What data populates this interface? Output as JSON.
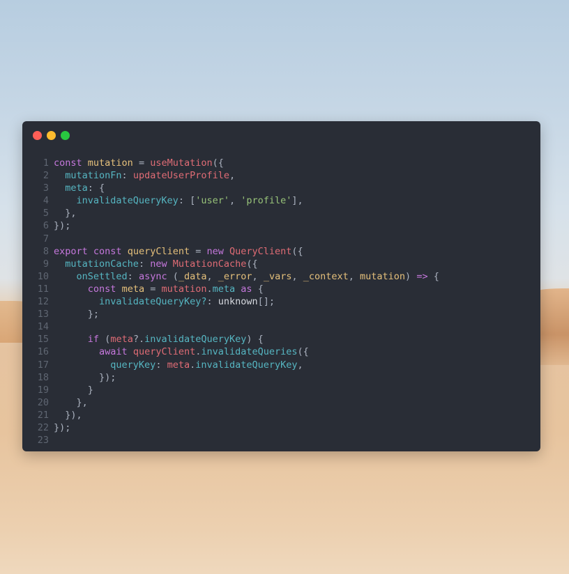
{
  "window": {
    "controls": [
      "close",
      "minimize",
      "maximize"
    ],
    "colors": {
      "close": "#ff5f57",
      "minimize": "#febc2e",
      "maximize": "#28c840"
    }
  },
  "code": {
    "lines": [
      {
        "n": "1",
        "tokens": [
          [
            "kw",
            "const "
          ],
          [
            "var",
            "mutation"
          ],
          [
            "punc",
            " = "
          ],
          [
            "fn",
            "useMutation"
          ],
          [
            "punc",
            "({"
          ]
        ]
      },
      {
        "n": "2",
        "tokens": [
          [
            "punc",
            "  "
          ],
          [
            "prop",
            "mutationFn"
          ],
          [
            "punc",
            ": "
          ],
          [
            "fn",
            "updateUserProfile"
          ],
          [
            "punc",
            ","
          ]
        ]
      },
      {
        "n": "3",
        "tokens": [
          [
            "punc",
            "  "
          ],
          [
            "prop",
            "meta"
          ],
          [
            "punc",
            ": {"
          ]
        ]
      },
      {
        "n": "4",
        "tokens": [
          [
            "punc",
            "    "
          ],
          [
            "prop",
            "invalidateQueryKey"
          ],
          [
            "punc",
            ": ["
          ],
          [
            "str",
            "'user'"
          ],
          [
            "punc",
            ", "
          ],
          [
            "str",
            "'profile'"
          ],
          [
            "punc",
            "],"
          ]
        ]
      },
      {
        "n": "5",
        "tokens": [
          [
            "punc",
            "  },"
          ]
        ]
      },
      {
        "n": "6",
        "tokens": [
          [
            "punc",
            "});"
          ]
        ]
      },
      {
        "n": "7",
        "tokens": []
      },
      {
        "n": "8",
        "tokens": [
          [
            "kw",
            "export "
          ],
          [
            "kw",
            "const "
          ],
          [
            "var",
            "queryClient"
          ],
          [
            "punc",
            " = "
          ],
          [
            "kw",
            "new "
          ],
          [
            "fn",
            "QueryClient"
          ],
          [
            "punc",
            "({"
          ]
        ]
      },
      {
        "n": "9",
        "tokens": [
          [
            "punc",
            "  "
          ],
          [
            "prop",
            "mutationCache"
          ],
          [
            "punc",
            ": "
          ],
          [
            "kw",
            "new "
          ],
          [
            "fn",
            "MutationCache"
          ],
          [
            "punc",
            "({"
          ]
        ]
      },
      {
        "n": "10",
        "tokens": [
          [
            "punc",
            "    "
          ],
          [
            "prop",
            "onSettled"
          ],
          [
            "punc",
            ": "
          ],
          [
            "kw",
            "async "
          ],
          [
            "punc",
            "("
          ],
          [
            "var",
            "_data"
          ],
          [
            "punc",
            ", "
          ],
          [
            "var",
            "_error"
          ],
          [
            "punc",
            ", "
          ],
          [
            "var",
            "_vars"
          ],
          [
            "punc",
            ", "
          ],
          [
            "var",
            "_context"
          ],
          [
            "punc",
            ", "
          ],
          [
            "var",
            "mutation"
          ],
          [
            "punc",
            ") "
          ],
          [
            "kw",
            "=>"
          ],
          [
            "punc",
            " {"
          ]
        ]
      },
      {
        "n": "11",
        "tokens": [
          [
            "punc",
            "      "
          ],
          [
            "kw",
            "const "
          ],
          [
            "var",
            "meta"
          ],
          [
            "punc",
            " = "
          ],
          [
            "fn",
            "mutation"
          ],
          [
            "punc",
            "."
          ],
          [
            "prop",
            "meta"
          ],
          [
            "punc",
            " "
          ],
          [
            "kw",
            "as"
          ],
          [
            "punc",
            " {"
          ]
        ]
      },
      {
        "n": "12",
        "tokens": [
          [
            "punc",
            "        "
          ],
          [
            "prop",
            "invalidateQueryKey?"
          ],
          [
            "punc",
            ": "
          ],
          [
            "plain",
            "unknown"
          ],
          [
            "punc",
            "[];"
          ]
        ]
      },
      {
        "n": "13",
        "tokens": [
          [
            "punc",
            "      };"
          ]
        ]
      },
      {
        "n": "14",
        "tokens": []
      },
      {
        "n": "15",
        "tokens": [
          [
            "punc",
            "      "
          ],
          [
            "kw",
            "if "
          ],
          [
            "punc",
            "("
          ],
          [
            "fn",
            "meta"
          ],
          [
            "punc",
            "?."
          ],
          [
            "prop",
            "invalidateQueryKey"
          ],
          [
            "punc",
            ") {"
          ]
        ]
      },
      {
        "n": "16",
        "tokens": [
          [
            "punc",
            "        "
          ],
          [
            "kw",
            "await "
          ],
          [
            "fn",
            "queryClient"
          ],
          [
            "punc",
            "."
          ],
          [
            "prop",
            "invalidateQueries"
          ],
          [
            "punc",
            "({"
          ]
        ]
      },
      {
        "n": "17",
        "tokens": [
          [
            "punc",
            "          "
          ],
          [
            "prop",
            "queryKey"
          ],
          [
            "punc",
            ": "
          ],
          [
            "fn",
            "meta"
          ],
          [
            "punc",
            "."
          ],
          [
            "prop",
            "invalidateQueryKey"
          ],
          [
            "punc",
            ","
          ]
        ]
      },
      {
        "n": "18",
        "tokens": [
          [
            "punc",
            "        });"
          ]
        ]
      },
      {
        "n": "19",
        "tokens": [
          [
            "punc",
            "      }"
          ]
        ]
      },
      {
        "n": "20",
        "tokens": [
          [
            "punc",
            "    },"
          ]
        ]
      },
      {
        "n": "21",
        "tokens": [
          [
            "punc",
            "  }),"
          ]
        ]
      },
      {
        "n": "22",
        "tokens": [
          [
            "punc",
            "});"
          ]
        ]
      },
      {
        "n": "23",
        "tokens": []
      }
    ]
  }
}
